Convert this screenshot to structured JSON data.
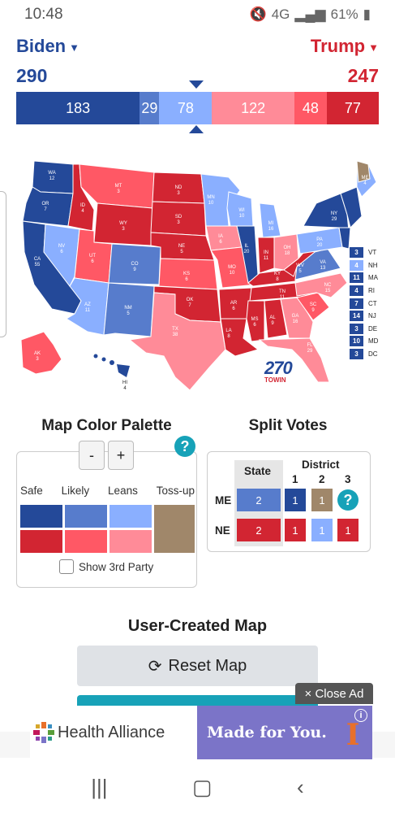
{
  "status": {
    "time": "10:48",
    "network": "4G",
    "battery": "61%"
  },
  "candidates": {
    "left": {
      "name": "Biden",
      "total": "290",
      "color": "#244999"
    },
    "right": {
      "name": "Trump",
      "total": "247",
      "color": "#d22532"
    }
  },
  "ev_bar": [
    {
      "value": "183",
      "color": "#244999",
      "ev": 183
    },
    {
      "value": "29",
      "color": "#577ccc",
      "ev": 29
    },
    {
      "value": "78",
      "color": "#8aafff",
      "ev": 78
    },
    {
      "value": "122",
      "color": "#ff8b98",
      "ev": 122
    },
    {
      "value": "48",
      "color": "#ff5865",
      "ev": 48
    },
    {
      "value": "77",
      "color": "#d22532",
      "ev": 77
    }
  ],
  "states": [
    {
      "abbr": "WA",
      "ev": "12"
    },
    {
      "abbr": "OR",
      "ev": "7"
    },
    {
      "abbr": "CA",
      "ev": "55"
    },
    {
      "abbr": "NV",
      "ev": "6"
    },
    {
      "abbr": "ID",
      "ev": "4"
    },
    {
      "abbr": "MT",
      "ev": "3"
    },
    {
      "abbr": "WY",
      "ev": "3"
    },
    {
      "abbr": "UT",
      "ev": "6"
    },
    {
      "abbr": "AZ",
      "ev": "11"
    },
    {
      "abbr": "CO",
      "ev": "9"
    },
    {
      "abbr": "NM",
      "ev": "5"
    },
    {
      "abbr": "ND",
      "ev": "3"
    },
    {
      "abbr": "SD",
      "ev": "3"
    },
    {
      "abbr": "NE",
      "ev": "5"
    },
    {
      "abbr": "KS",
      "ev": "6"
    },
    {
      "abbr": "OK",
      "ev": "7"
    },
    {
      "abbr": "TX",
      "ev": "38"
    },
    {
      "abbr": "MN",
      "ev": "10"
    },
    {
      "abbr": "IA",
      "ev": "6"
    },
    {
      "abbr": "MO",
      "ev": "10"
    },
    {
      "abbr": "AR",
      "ev": "6"
    },
    {
      "abbr": "LA",
      "ev": "8"
    },
    {
      "abbr": "WI",
      "ev": "10"
    },
    {
      "abbr": "IL",
      "ev": "20"
    },
    {
      "abbr": "MI",
      "ev": "16"
    },
    {
      "abbr": "IN",
      "ev": "11"
    },
    {
      "abbr": "OH",
      "ev": "18"
    },
    {
      "abbr": "KY",
      "ev": "8"
    },
    {
      "abbr": "TN",
      "ev": "11"
    },
    {
      "abbr": "MS",
      "ev": "6"
    },
    {
      "abbr": "AL",
      "ev": "9"
    },
    {
      "abbr": "GA",
      "ev": "16"
    },
    {
      "abbr": "FL",
      "ev": "29"
    },
    {
      "abbr": "SC",
      "ev": "9"
    },
    {
      "abbr": "NC",
      "ev": "15"
    },
    {
      "abbr": "VA",
      "ev": "13"
    },
    {
      "abbr": "WV",
      "ev": "5"
    },
    {
      "abbr": "PA",
      "ev": "20"
    },
    {
      "abbr": "NY",
      "ev": "29"
    },
    {
      "abbr": "ME",
      "ev": "4"
    },
    {
      "abbr": "AK",
      "ev": "3"
    },
    {
      "abbr": "HI",
      "ev": "4"
    }
  ],
  "small_states": [
    {
      "ev": "3",
      "abbr": "VT",
      "color": "#244999"
    },
    {
      "ev": "4",
      "abbr": "NH",
      "color": "#8aafff"
    },
    {
      "ev": "11",
      "abbr": "MA",
      "color": "#244999"
    },
    {
      "ev": "4",
      "abbr": "RI",
      "color": "#244999"
    },
    {
      "ev": "7",
      "abbr": "CT",
      "color": "#244999"
    },
    {
      "ev": "14",
      "abbr": "NJ",
      "color": "#244999"
    },
    {
      "ev": "3",
      "abbr": "DE",
      "color": "#244999"
    },
    {
      "ev": "10",
      "abbr": "MD",
      "color": "#244999"
    },
    {
      "ev": "3",
      "abbr": "DC",
      "color": "#244999"
    }
  ],
  "logo": {
    "number": "270",
    "text": "TOWIN"
  },
  "palette": {
    "title": "Map Color Palette",
    "minus": "-",
    "plus": "+",
    "help": "?",
    "labels": [
      "Safe",
      "Likely",
      "Leans",
      "Toss-up"
    ],
    "show_third_party": "Show 3rd Party",
    "colors": {
      "dem_safe": "#244999",
      "dem_likely": "#577ccc",
      "dem_leans": "#8aafff",
      "rep_safe": "#d22532",
      "rep_likely": "#ff5865",
      "rep_leans": "#ff8b98",
      "tossup": "#a0876a"
    }
  },
  "split_votes": {
    "title": "Split Votes",
    "state_header": "State",
    "district_header": "District",
    "districts": [
      "1",
      "2",
      "3"
    ],
    "help": "?",
    "rows": [
      {
        "state": "ME",
        "state_value": "2",
        "d1": "1",
        "d2": "1"
      },
      {
        "state": "NE",
        "state_value": "2",
        "d1": "1",
        "d2": "1",
        "d3": "1"
      }
    ]
  },
  "user_map": {
    "title": "User-Created Map",
    "reset_label": "Reset Map"
  },
  "ad": {
    "close_label": "× Close Ad",
    "brand": "Health Alliance",
    "tagline": "Made for You.",
    "logo_letter": "I",
    "info": "i"
  }
}
